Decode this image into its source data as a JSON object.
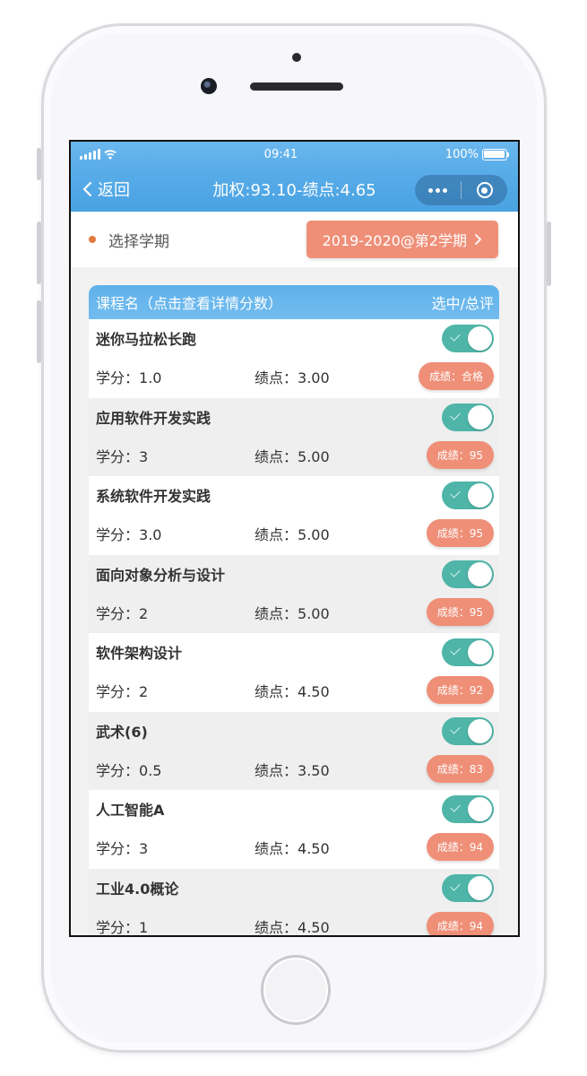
{
  "status_bar": {
    "time": "09:41",
    "battery": "100%"
  },
  "nav": {
    "back_label": "返回",
    "title": "加权:93.10-绩点:4.65"
  },
  "semester": {
    "label": "选择学期",
    "selected": "2019-2020@第2学期"
  },
  "table": {
    "header_left": "课程名（点击查看详情分数）",
    "header_right": "选中/总评",
    "credit_prefix": "学分：",
    "point_prefix": "绩点：",
    "courses": [
      {
        "name": "迷你马拉松长跑",
        "credit": "1.0",
        "gpa": "3.00",
        "score": "成绩：合格",
        "selected": true
      },
      {
        "name": "应用软件开发实践",
        "credit": "3",
        "gpa": "5.00",
        "score": "成绩：95",
        "selected": true
      },
      {
        "name": "系统软件开发实践",
        "credit": "3.0",
        "gpa": "5.00",
        "score": "成绩：95",
        "selected": true
      },
      {
        "name": "面向对象分析与设计",
        "credit": "2",
        "gpa": "5.00",
        "score": "成绩：95",
        "selected": true
      },
      {
        "name": "软件架构设计",
        "credit": "2",
        "gpa": "4.50",
        "score": "成绩：92",
        "selected": true
      },
      {
        "name": "武术(6)",
        "credit": "0.5",
        "gpa": "3.50",
        "score": "成绩：83",
        "selected": true
      },
      {
        "name": "人工智能A",
        "credit": "3",
        "gpa": "4.50",
        "score": "成绩：94",
        "selected": true
      },
      {
        "name": "工业4.0概论",
        "credit": "1",
        "gpa": "4.50",
        "score": "成绩：94",
        "selected": true
      }
    ]
  },
  "colors": {
    "accent_blue": "#5aaee9",
    "toggle_on": "#4fb5a8",
    "score_badge": "#ef8f78",
    "dot_orange": "#e07a3c"
  }
}
